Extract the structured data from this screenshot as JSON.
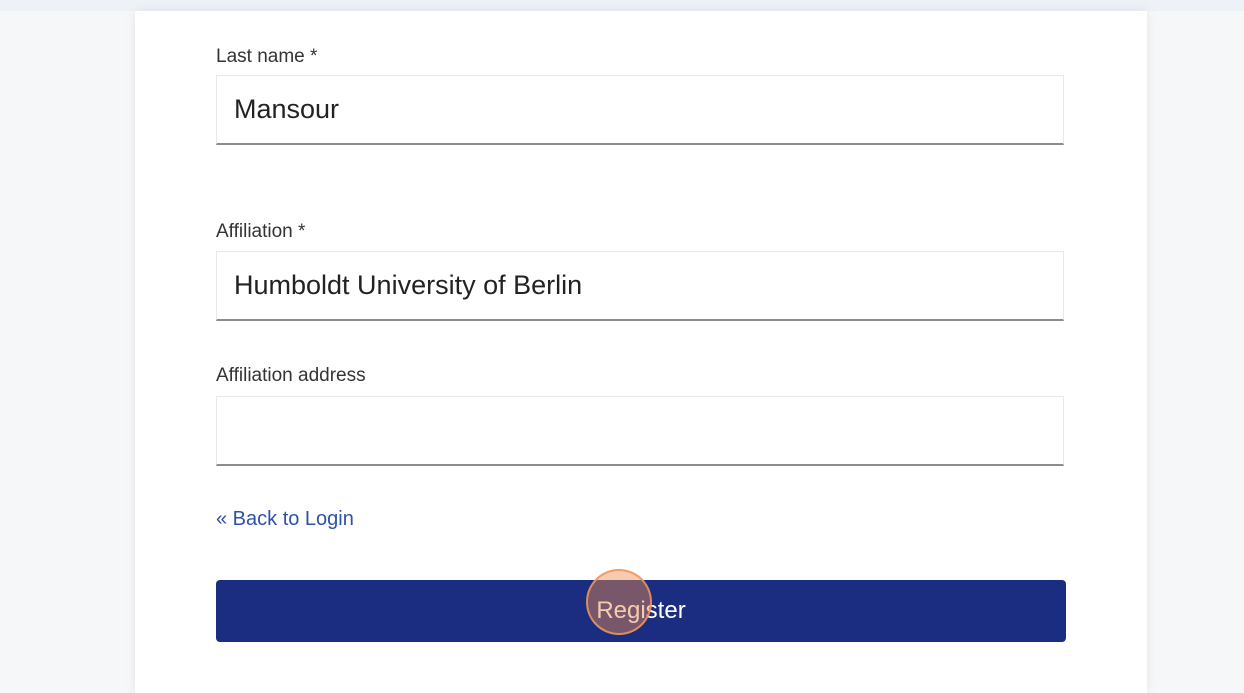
{
  "form": {
    "last_name": {
      "label": "Last name *",
      "value": "Mansour"
    },
    "affiliation": {
      "label": "Affiliation *",
      "value": "Humboldt University of Berlin"
    },
    "affiliation_address": {
      "label": "Affiliation address",
      "value": ""
    },
    "back_link": "« Back to Login",
    "register_button": "Register"
  },
  "colors": {
    "button_bg": "#1b2d80",
    "link": "#2f52a6",
    "click_indicator": "#eb8c50"
  }
}
